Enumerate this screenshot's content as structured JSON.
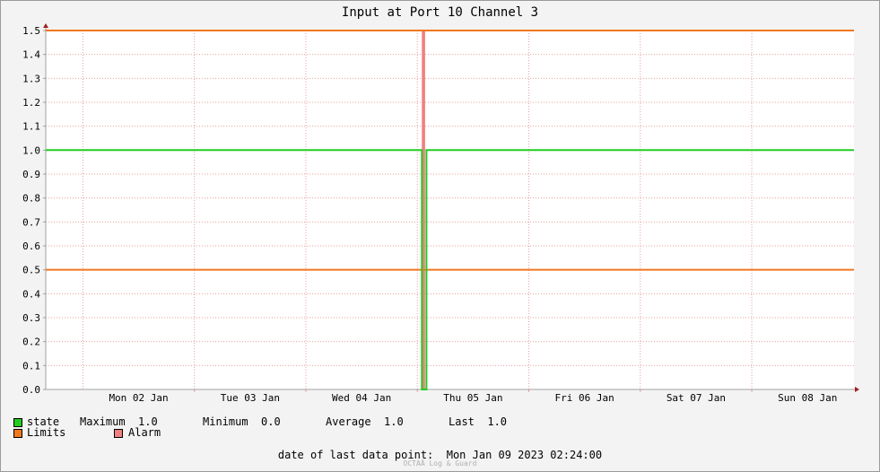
{
  "chart_data": {
    "type": "line",
    "title": "Input at Port 10 Channel 3",
    "ylim": [
      0.0,
      1.5
    ],
    "yticks": [
      "0.0",
      "0.1",
      "0.2",
      "0.3",
      "0.4",
      "0.5",
      "0.6",
      "0.7",
      "0.8",
      "0.9",
      "1.0",
      "1.1",
      "1.2",
      "1.3",
      "1.4",
      "1.5"
    ],
    "x_range": [
      "2023-01-01T16:00",
      "2023-01-08T22:00"
    ],
    "xticks": [
      {
        "label": "Mon 02 Jan",
        "x": "2023-01-02T00:00"
      },
      {
        "label": "Tue 03 Jan",
        "x": "2023-01-03T00:00"
      },
      {
        "label": "Wed 04 Jan",
        "x": "2023-01-04T00:00"
      },
      {
        "label": "Thu 05 Jan",
        "x": "2023-01-05T00:00"
      },
      {
        "label": "Fri 06 Jan",
        "x": "2023-01-06T00:00"
      },
      {
        "label": "Sat 07 Jan",
        "x": "2023-01-07T00:00"
      },
      {
        "label": "Sun 08 Jan",
        "x": "2023-01-08T00:00"
      }
    ],
    "grid": true,
    "series": [
      {
        "name": "state",
        "color": "#22cc22",
        "points": [
          {
            "x": "2023-01-01T16:00",
            "y": 1.0
          },
          {
            "x": "2023-01-05T00:58",
            "y": 1.0
          },
          {
            "x": "2023-01-05T00:58",
            "y": 0.0
          },
          {
            "x": "2023-01-05T01:58",
            "y": 0.0
          },
          {
            "x": "2023-01-05T01:58",
            "y": 1.0
          },
          {
            "x": "2023-01-08T22:00",
            "y": 1.0
          }
        ]
      }
    ],
    "limits": {
      "name": "Limits",
      "color": "#f07820",
      "values": [
        0.5,
        1.5
      ]
    },
    "alarm": {
      "name": "Alarm",
      "color": "#f08080",
      "start": "2023-01-05T00:58",
      "end": "2023-01-05T01:40"
    }
  },
  "legend": {
    "state_label": "state",
    "maximum": "Maximum  1.0",
    "minimum": "Minimum  0.0",
    "average": "Average  1.0",
    "last": "Last  1.0",
    "limits_label": "Limits",
    "alarm_label": "Alarm",
    "state_color": "#22cc22",
    "limits_color": "#f07820",
    "alarm_color": "#f08080"
  },
  "footer": {
    "last_data_point": "date of last data point:  Mon Jan 09 2023 02:24:00",
    "watermark": "OCTAÄ Log & Guard"
  }
}
